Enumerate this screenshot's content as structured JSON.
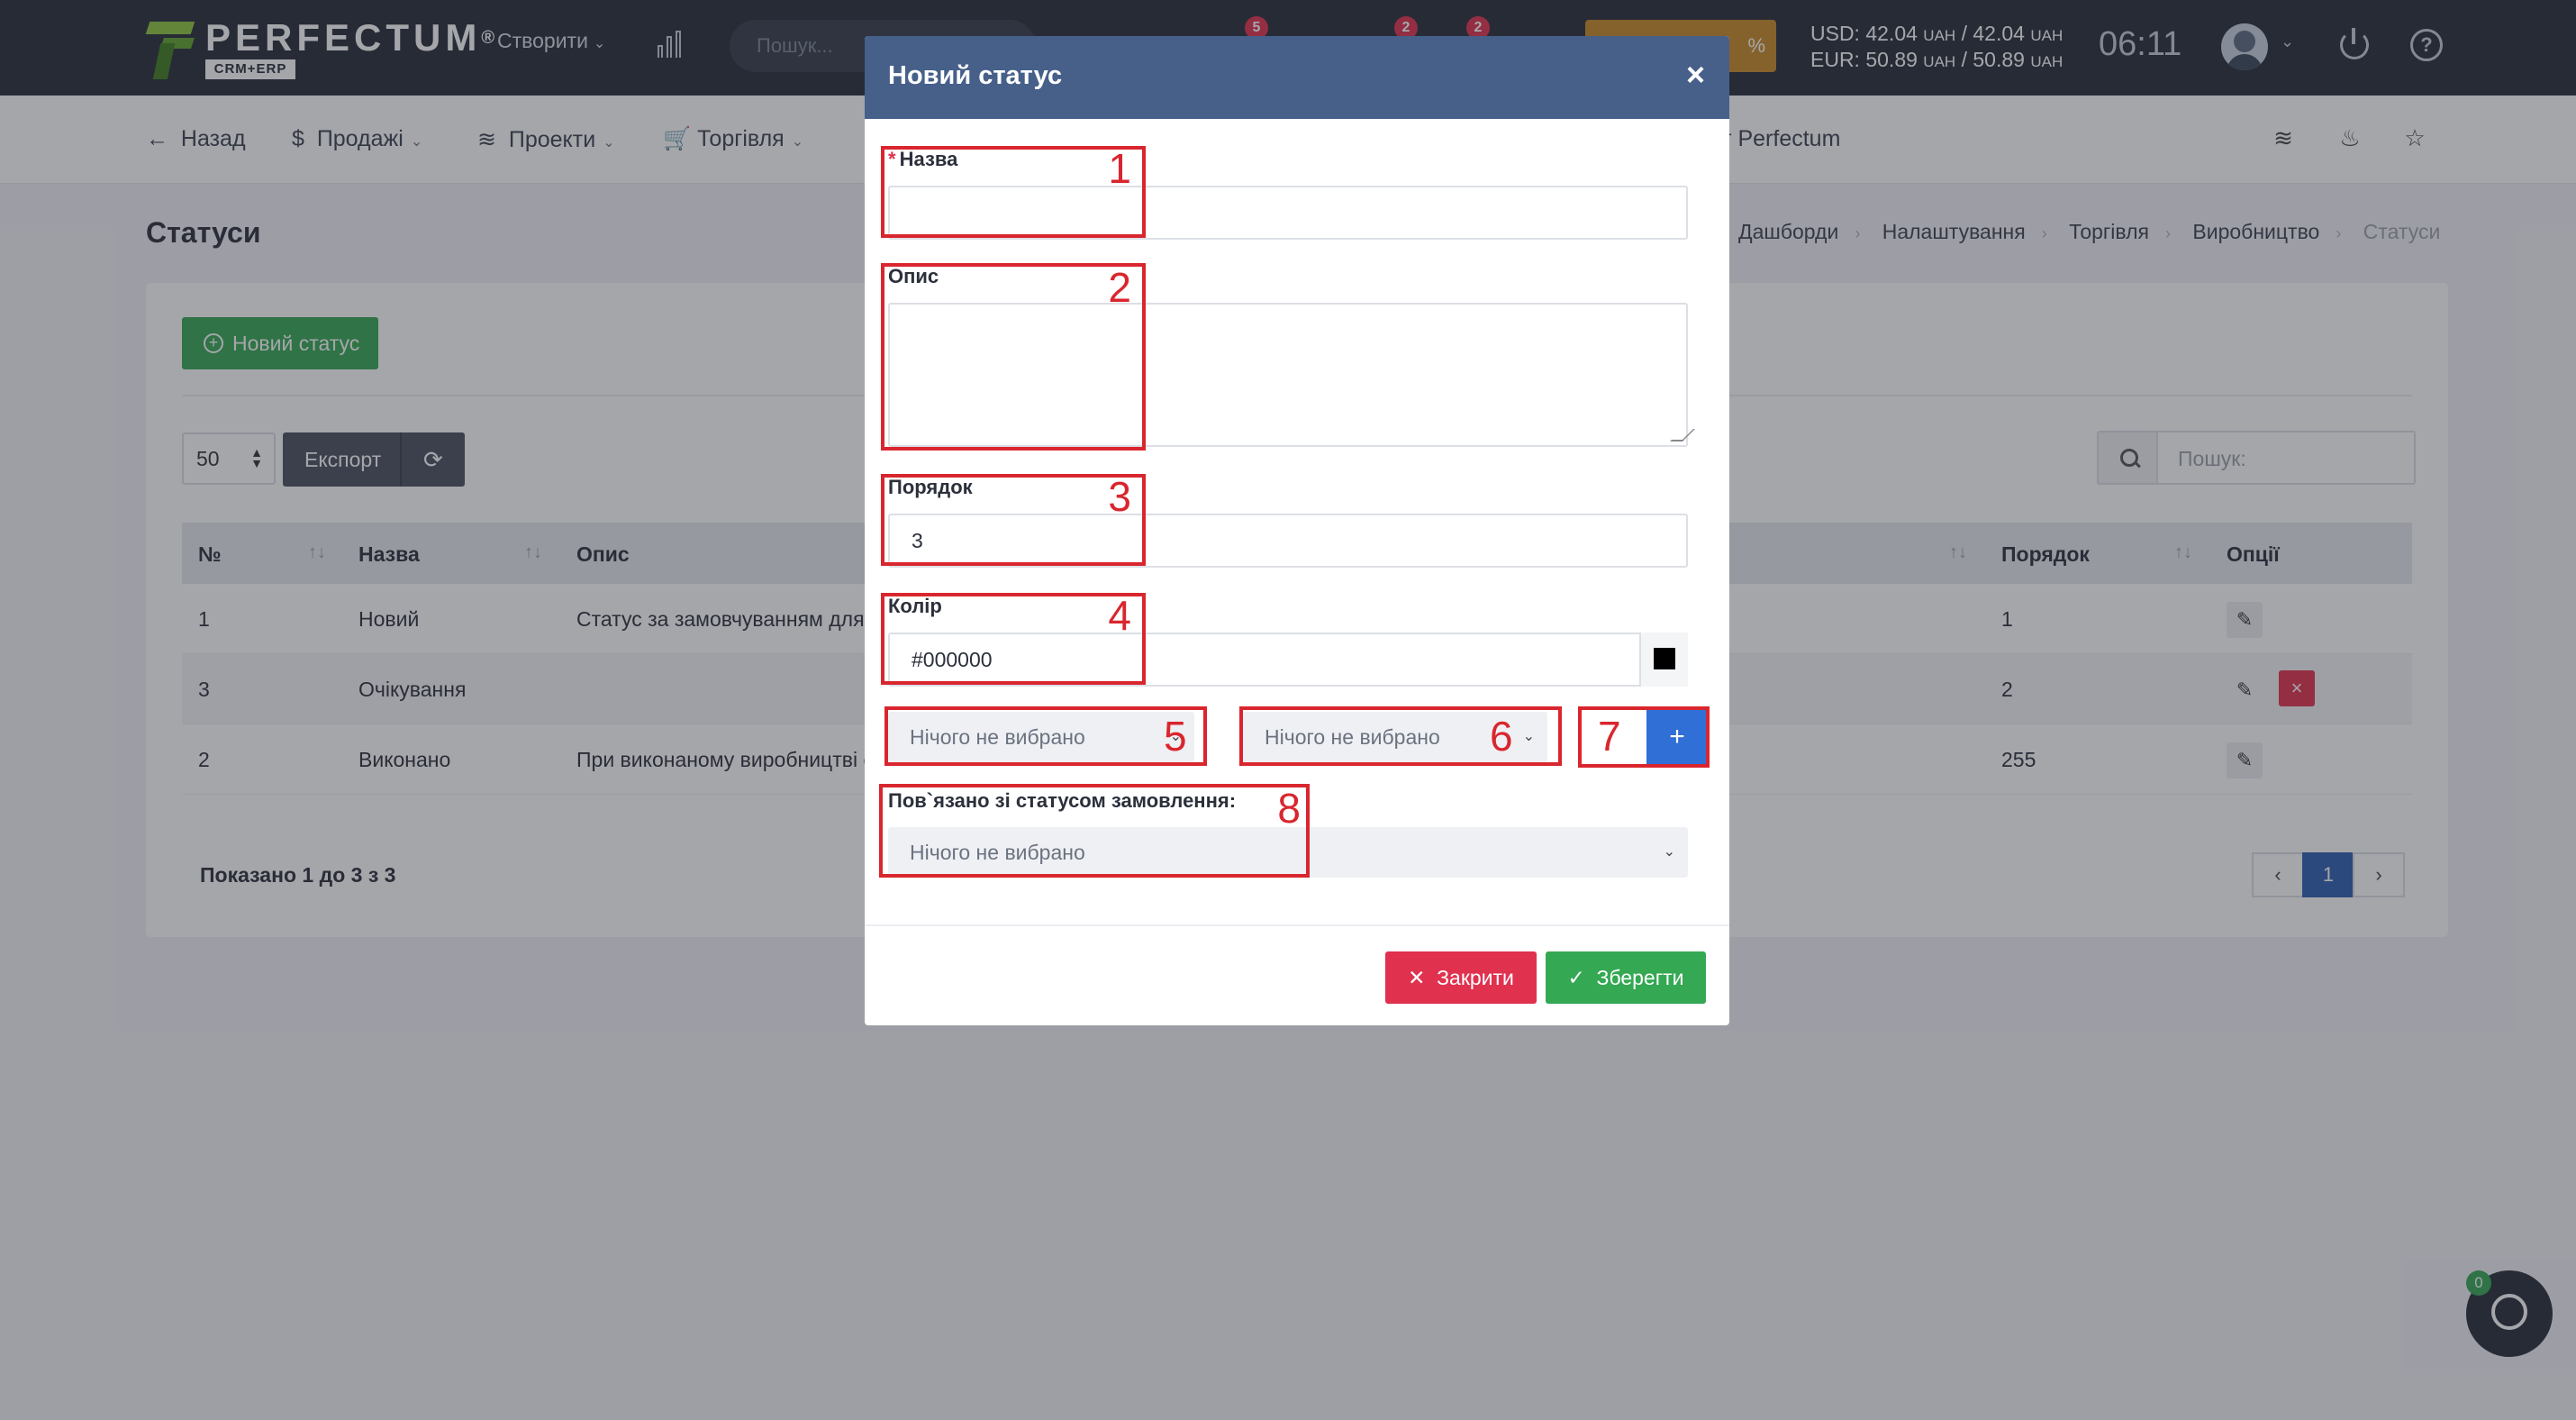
{
  "topbar": {
    "brand": "PERFECTUM",
    "brand_mark": "®",
    "brand_sub": "CRM+ERP",
    "create_label": "Створити",
    "search_placeholder": "Пошук...",
    "badges": [
      "5",
      "2",
      "2"
    ],
    "promo_suffix": "%",
    "usd_rate": "USD: 42.04",
    "eur_rate": "EUR: 50.89",
    "usd_rate2": "/ 42.04",
    "eur_rate2": "/ 50.89",
    "currency": "UAH",
    "time": "06:11",
    "icons": [
      "chart-icon",
      "power-icon",
      "help-icon"
    ]
  },
  "nav": {
    "back": "Назад",
    "sales": "Продажі",
    "projects": "Проекти",
    "trade": "Торгівля",
    "partial_right": "ет Perfectum"
  },
  "page": {
    "title": "Статуси",
    "breadcrumb": [
      "Дашборди",
      "Налаштування",
      "Торгівля",
      "Виробництво",
      "Статуси"
    ]
  },
  "toolbar": {
    "new_status": "Новий статус",
    "page_size": "50",
    "export": "Експорт",
    "search_placeholder": "Пошук:"
  },
  "table": {
    "headers": {
      "num": "№",
      "name": "Назва",
      "desc": "Опис",
      "order": "Порядок",
      "options": "Опції"
    },
    "rows": [
      {
        "num": "1",
        "name": "Новий",
        "desc": "Статус за замовчуванням для н",
        "order": "1"
      },
      {
        "num": "3",
        "name": "Очікування",
        "desc": "",
        "order": "2"
      },
      {
        "num": "2",
        "name": "Виконано",
        "desc": "При виконаному виробництві с",
        "order": "255"
      }
    ],
    "shown": "Показано 1 до 3 з 3",
    "current_page": "1"
  },
  "chat": {
    "badge": "0"
  },
  "modal": {
    "title": "Новий статус",
    "close_x": "×",
    "name_required": "*",
    "name_label": "Назва",
    "name_value": "",
    "desc_label": "Опис",
    "order_label": "Порядок",
    "order_value": "3",
    "color_label": "Колір",
    "color_value": "#000000",
    "select_1": "Нічого не вибрано",
    "select_2": "Нічого не вибрано",
    "add_label": "+",
    "linked_label": "Пов`язано зі статусом замовлення:",
    "linked_value": "Нічого не вибрано",
    "close_button": "Закрити",
    "save_button": "Зберегти"
  },
  "annotations": [
    "1",
    "2",
    "3",
    "4",
    "5",
    "6",
    "7",
    "8"
  ],
  "colors": {
    "header": "#46608a",
    "save": "#34a853",
    "close": "#e0314f",
    "add": "#2f6fd6",
    "annotation": "#d9262e"
  }
}
